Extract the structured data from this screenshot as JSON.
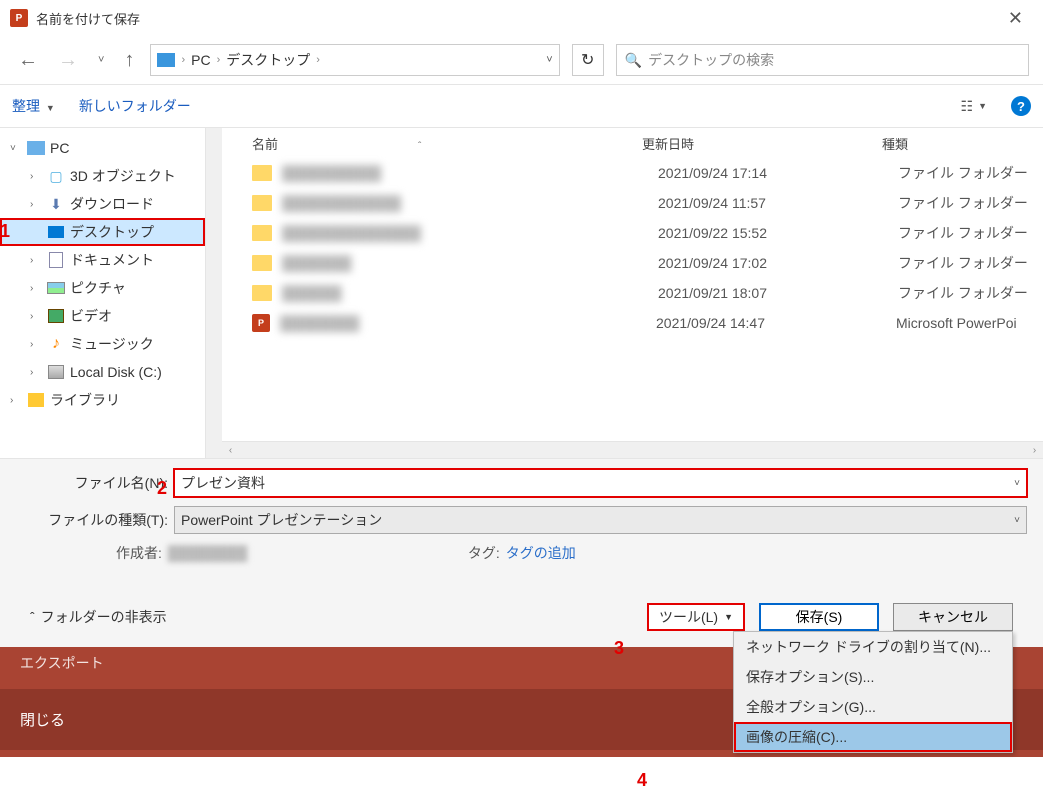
{
  "titlebar": {
    "title": "名前を付けて保存"
  },
  "nav": {
    "crumbs": [
      "PC",
      "デスクトップ"
    ],
    "search_placeholder": "デスクトップの検索"
  },
  "toolbar": {
    "organize": "整理",
    "new_folder": "新しいフォルダー"
  },
  "tree": [
    {
      "label": "PC",
      "level": 1,
      "icon": "pc",
      "exp": "v"
    },
    {
      "label": "3D オブジェクト",
      "level": 2,
      "icon": "3d",
      "exp": ">"
    },
    {
      "label": "ダウンロード",
      "level": 2,
      "icon": "dl",
      "exp": ">"
    },
    {
      "label": "デスクトップ",
      "level": 2,
      "icon": "desktop",
      "exp": "",
      "selected": true,
      "red": true
    },
    {
      "label": "ドキュメント",
      "level": 2,
      "icon": "doc",
      "exp": ">"
    },
    {
      "label": "ピクチャ",
      "level": 2,
      "icon": "pic",
      "exp": ">"
    },
    {
      "label": "ビデオ",
      "level": 2,
      "icon": "vid",
      "exp": ">"
    },
    {
      "label": "ミュージック",
      "level": 2,
      "icon": "music",
      "exp": ">"
    },
    {
      "label": "Local Disk (C:)",
      "level": 2,
      "icon": "disk",
      "exp": ">"
    },
    {
      "label": "ライブラリ",
      "level": 1,
      "icon": "lib",
      "exp": ">"
    }
  ],
  "columns": {
    "name": "名前",
    "date": "更新日時",
    "type": "種類"
  },
  "files": [
    {
      "kind": "folder",
      "name": "██████████",
      "date": "2021/09/24 17:14",
      "type": "ファイル フォルダー"
    },
    {
      "kind": "folder",
      "name": "████████████",
      "date": "2021/09/24 11:57",
      "type": "ファイル フォルダー"
    },
    {
      "kind": "folder",
      "name": "██████████████",
      "date": "2021/09/22 15:52",
      "type": "ファイル フォルダー"
    },
    {
      "kind": "folder",
      "name": "███████",
      "date": "2021/09/24 17:02",
      "type": "ファイル フォルダー"
    },
    {
      "kind": "folder",
      "name": "██████",
      "date": "2021/09/21 18:07",
      "type": "ファイル フォルダー"
    },
    {
      "kind": "ppt",
      "name": "████████",
      "date": "2021/09/24 14:47",
      "type": "Microsoft PowerPoi"
    }
  ],
  "form": {
    "filename_label": "ファイル名(N):",
    "filename_value": "プレゼン資料",
    "filetype_label": "ファイルの種類(T):",
    "filetype_value": "PowerPoint プレゼンテーション",
    "author_label": "作成者:",
    "author_value": "████████",
    "tag_label": "タグ:",
    "tag_link": "タグの追加"
  },
  "actions": {
    "hide_folders": "フォルダーの非表示",
    "tools": "ツール(L)",
    "save": "保存(S)",
    "cancel": "キャンセル"
  },
  "tools_menu": [
    "ネットワーク ドライブの割り当て(N)...",
    "保存オプション(S)...",
    "全般オプション(G)...",
    "画像の圧縮(C)..."
  ],
  "bottom_strip": {
    "row1": "エクスポート",
    "row2": "閉じる"
  },
  "annotations": {
    "a1": "1",
    "a2": "2",
    "a3": "3",
    "a4": "4"
  }
}
